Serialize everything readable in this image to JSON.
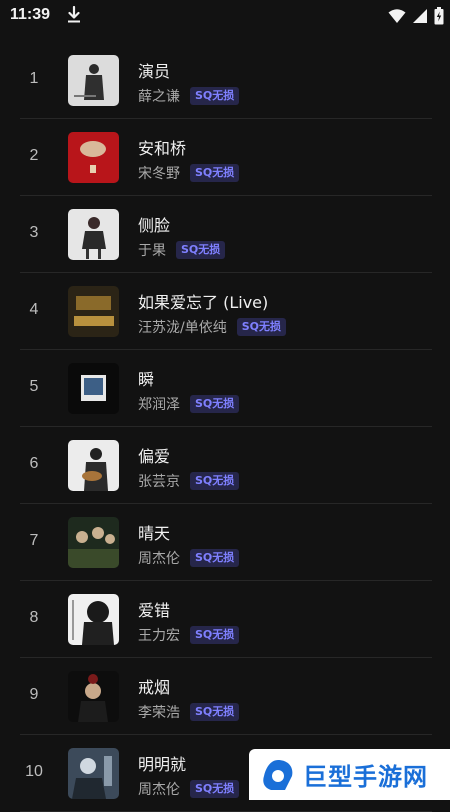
{
  "status_bar": {
    "time": "11:39",
    "icons": [
      "download-icon",
      "wifi-icon",
      "signal-icon",
      "battery-icon"
    ]
  },
  "songs": [
    {
      "rank": "1",
      "title": "演员",
      "artist": "薛之谦",
      "badge": "SQ无损"
    },
    {
      "rank": "2",
      "title": "安和桥",
      "artist": "宋冬野",
      "badge": "SQ无损"
    },
    {
      "rank": "3",
      "title": "侧脸",
      "artist": "于果",
      "badge": "SQ无损"
    },
    {
      "rank": "4",
      "title": "如果爱忘了 (Live)",
      "artist": "汪苏泷/单依纯",
      "badge": "SQ无损"
    },
    {
      "rank": "5",
      "title": "瞬",
      "artist": "郑润泽",
      "badge": "SQ无损"
    },
    {
      "rank": "6",
      "title": "偏爱",
      "artist": "张芸京",
      "badge": "SQ无损"
    },
    {
      "rank": "7",
      "title": "晴天",
      "artist": "周杰伦",
      "badge": "SQ无损"
    },
    {
      "rank": "8",
      "title": "爱错",
      "artist": "王力宏",
      "badge": "SQ无损"
    },
    {
      "rank": "9",
      "title": "戒烟",
      "artist": "李荣浩",
      "badge": "SQ无损"
    },
    {
      "rank": "10",
      "title": "明明就",
      "artist": "周杰伦",
      "badge": "SQ无损"
    }
  ],
  "watermark": {
    "text": "巨型手游网"
  },
  "colors": {
    "background": "#121212",
    "badge_text": "#7f80ff",
    "badge_bg": "#26264a",
    "watermark_blue": "#1a6fd8"
  }
}
